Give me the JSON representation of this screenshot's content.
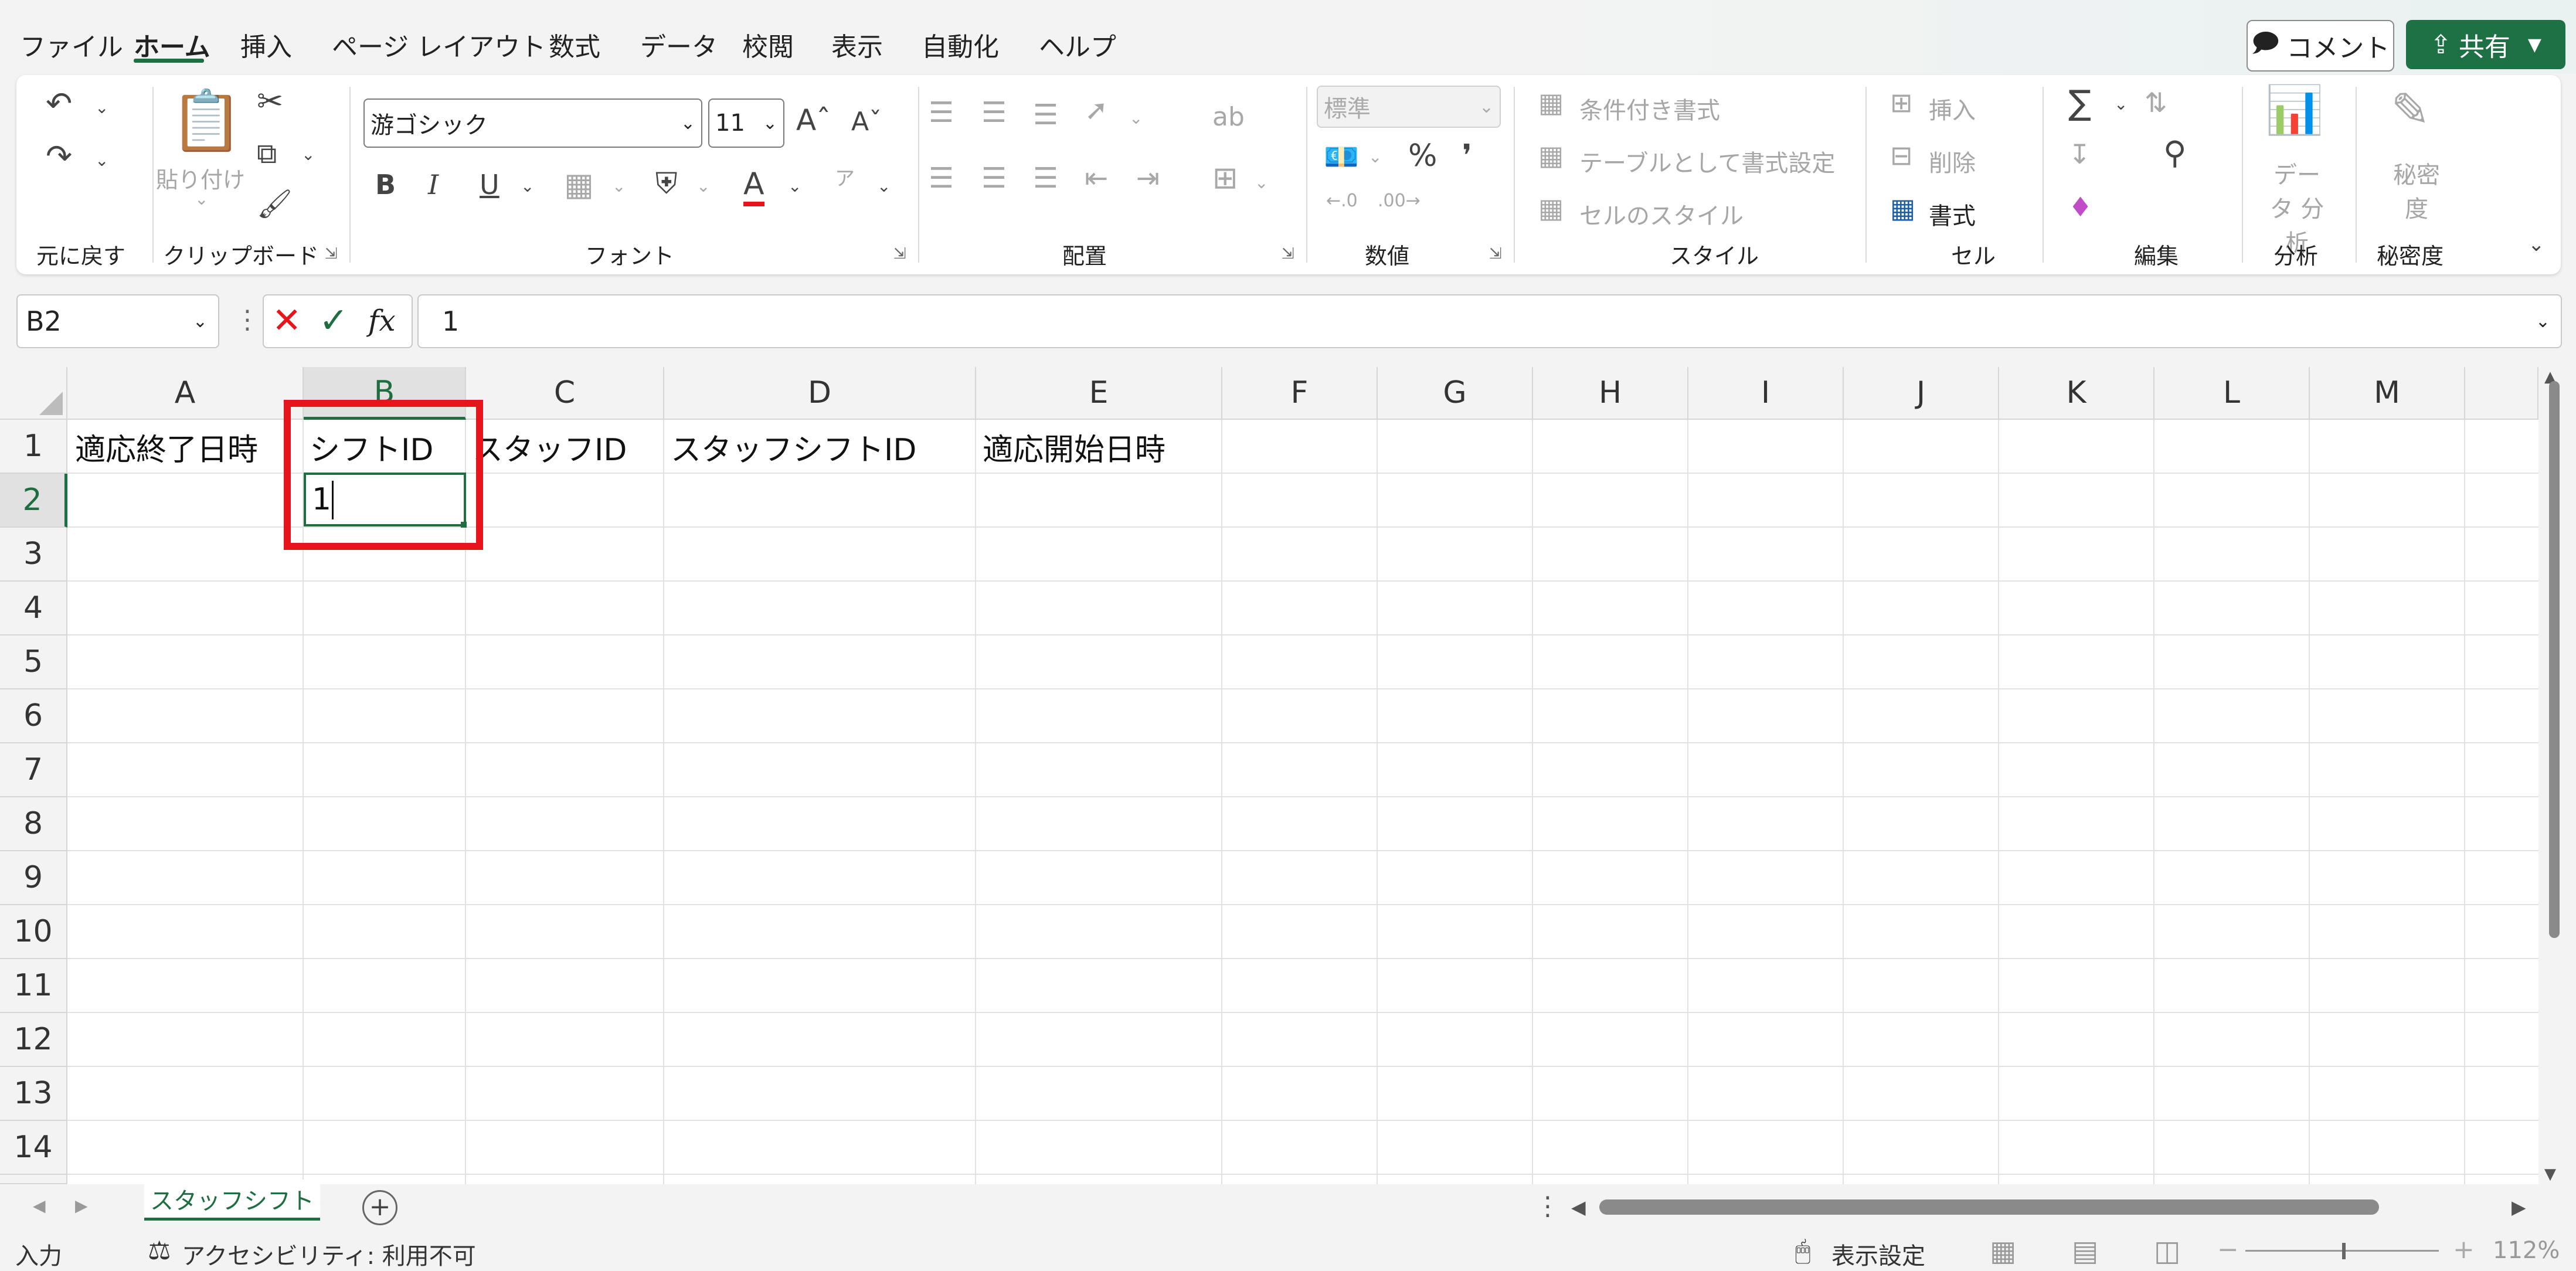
{
  "menu": {
    "tabs": [
      "ファイル",
      "ホーム",
      "挿入",
      "ページ レイアウト",
      "数式",
      "データ",
      "校閲",
      "表示",
      "自動化",
      "ヘルプ"
    ],
    "active_tab": "ホーム",
    "comment_label": "コメント",
    "share_label": "共有"
  },
  "ribbon": {
    "undo_group": {
      "label": "元に戻す"
    },
    "clipboard": {
      "label": "クリップボード",
      "paste_label": "貼り付け"
    },
    "font": {
      "label": "フォント",
      "font_name": "游ゴシック",
      "font_size": "11",
      "bold": "B",
      "italic": "I",
      "underline": "U",
      "font_color": "#e8141b"
    },
    "alignment": {
      "label": "配置"
    },
    "number": {
      "label": "数値",
      "format": "標準"
    },
    "styles": {
      "label": "スタイル",
      "conditional": "条件付き書式",
      "table": "テーブルとして書式設定",
      "cell_styles": "セルのスタイル"
    },
    "cells": {
      "label": "セル",
      "insert": "挿入",
      "delete": "削除",
      "format": "書式"
    },
    "editing": {
      "label": "編集"
    },
    "analysis": {
      "label": "分析",
      "data_analysis": "データ 分析"
    },
    "sensitivity": {
      "label": "秘密度",
      "button": "秘密 度"
    }
  },
  "formula_bar": {
    "name_box": "B2",
    "fx": "fx",
    "value": "1"
  },
  "grid": {
    "columns": [
      "A",
      "B",
      "C",
      "D",
      "E",
      "F",
      "G",
      "H",
      "I",
      "J",
      "K",
      "L",
      "M"
    ],
    "rows": [
      "1",
      "2",
      "3",
      "4",
      "5",
      "6",
      "7",
      "8",
      "9",
      "10",
      "11",
      "12",
      "13",
      "14"
    ],
    "selected_column": "B",
    "selected_row": "2",
    "row1": [
      "適応終了日時",
      "シフトID",
      "スタッフID",
      "スタッフシフトID",
      "適応開始日時"
    ],
    "active_cell_value": "1"
  },
  "sheets": {
    "tabs": [
      "スタッフシフト"
    ]
  },
  "status": {
    "mode": "入力",
    "accessibility": "アクセシビリティ: 利用不可",
    "display_settings": "表示設定",
    "zoom": "112%"
  },
  "colors": {
    "accent": "#1e6e42",
    "highlight": "#e8141b",
    "share": "#1e7145"
  }
}
